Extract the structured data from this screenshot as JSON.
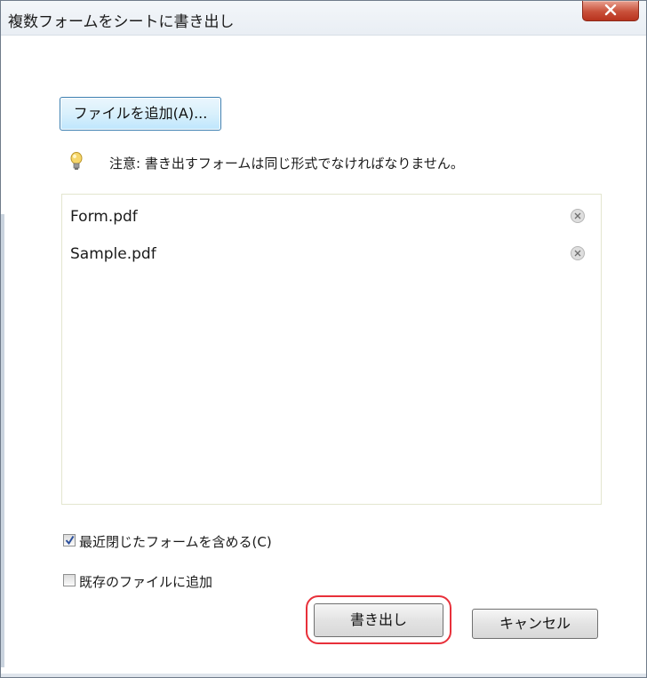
{
  "window": {
    "title": "複数フォームをシートに書き出し",
    "close_icon": "close-icon"
  },
  "toolbar": {
    "add_file_label": "ファイルを追加(A)..."
  },
  "note": {
    "icon": "lightbulb-icon",
    "text": "注意: 書き出すフォームは同じ形式でなければなりません。"
  },
  "file_list": {
    "items": [
      {
        "name": "Form.pdf",
        "remove_icon": "remove-icon"
      },
      {
        "name": "Sample.pdf",
        "remove_icon": "remove-icon"
      }
    ]
  },
  "options": {
    "include_recent": {
      "label": "最近閉じたフォームを含める(C)",
      "checked": true
    },
    "append_existing": {
      "label": "既存のファイルに追加",
      "checked": false
    }
  },
  "buttons": {
    "export_label": "書き出し",
    "cancel_label": "キャンセル"
  },
  "colors": {
    "highlight": "#e8303a",
    "close_button": "#c9503a",
    "focus_border": "#3c7fb1"
  }
}
